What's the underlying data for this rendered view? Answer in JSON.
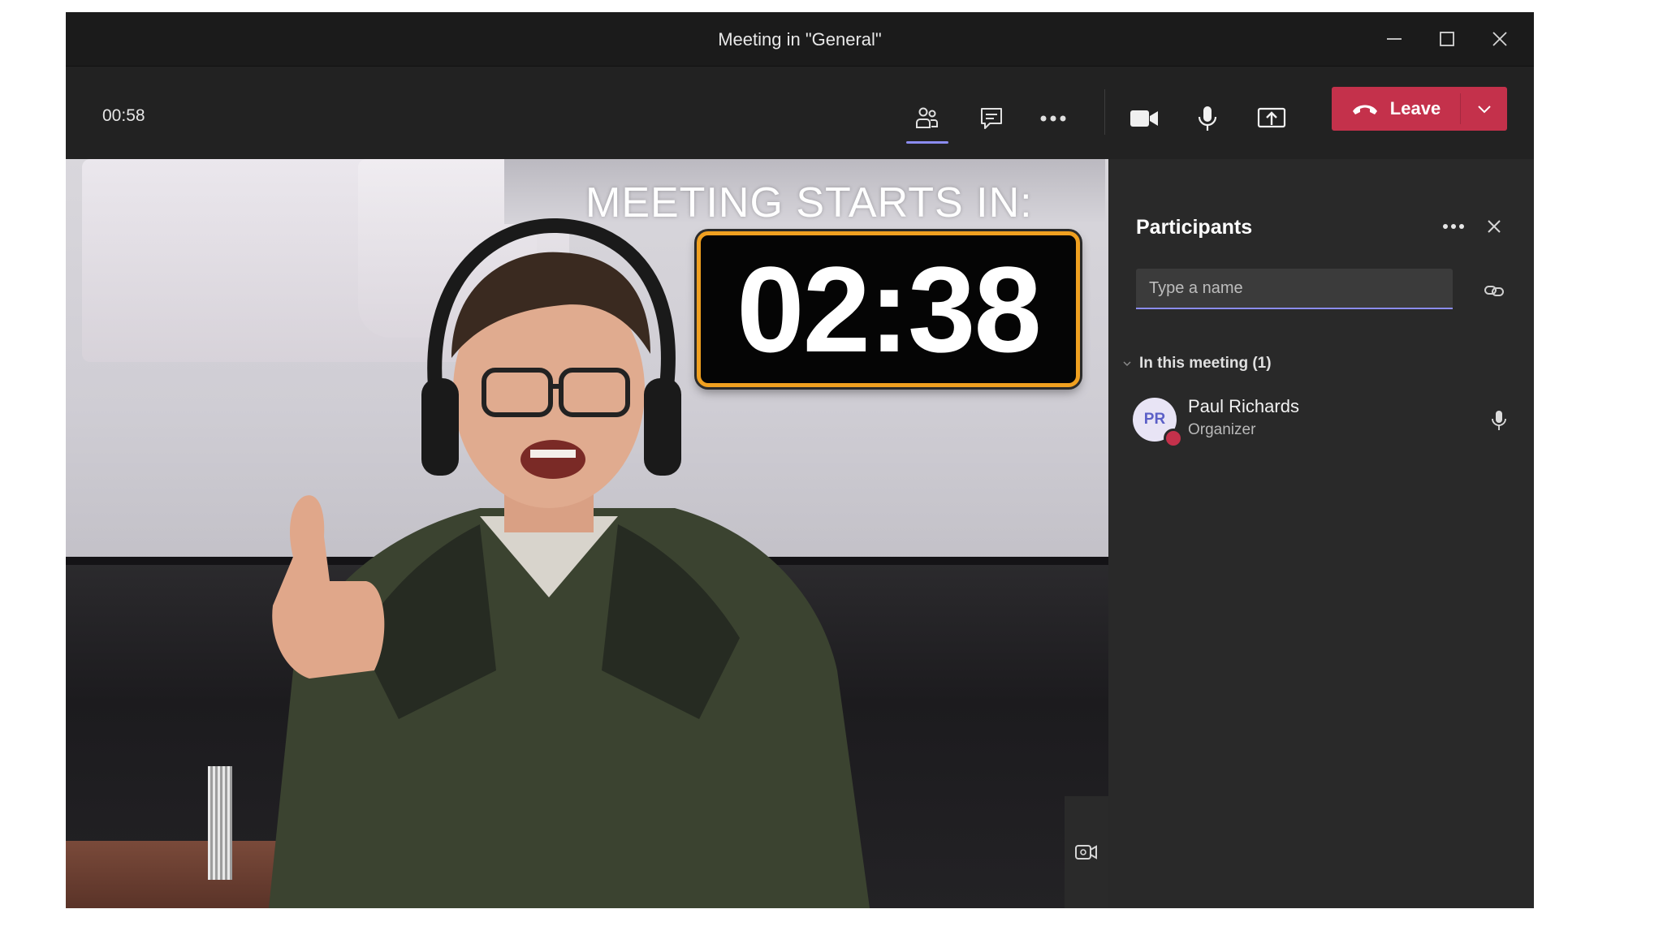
{
  "window": {
    "title": "Meeting in \"General\"",
    "controls": [
      "minimize-icon",
      "maximize-icon",
      "close-icon"
    ]
  },
  "toolbar": {
    "elapsed": "00:58",
    "icons": [
      "participants-icon",
      "chat-icon",
      "more-icon",
      "camera-icon",
      "microphone-icon",
      "share-screen-icon"
    ],
    "leave_label": "Leave",
    "leave_color": "#c4314b",
    "accent_color": "#8b8cf0"
  },
  "video": {
    "banner": "MEETING STARTS IN:",
    "countdown": "02:38",
    "countdown_border_color": "#f0a020"
  },
  "participants_panel": {
    "title": "Participants",
    "search": {
      "placeholder": "Type a name",
      "value": ""
    },
    "section_label": "In this meeting (1)",
    "people": [
      {
        "initials": "PR",
        "name": "Paul Richards",
        "role": "Organizer",
        "status_color": "#c4314b"
      }
    ]
  }
}
